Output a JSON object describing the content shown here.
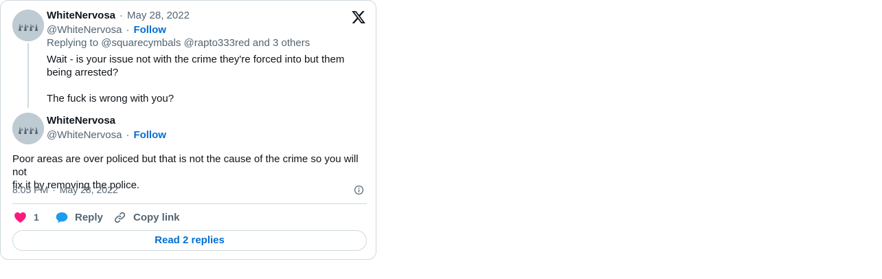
{
  "parent_tweet": {
    "author_name": "WhiteNervosa",
    "date": "May 28, 2022",
    "handle": "@WhiteNervosa",
    "follow_label": "Follow",
    "replying_prefix": "Replying to",
    "mention_1": "@squarecymbals",
    "mention_2": "@rapto333red",
    "replying_suffix": "and 3 others",
    "text_line1": "Wait - is your issue not with the crime they're forced into but them",
    "text_line2": "being arrested?",
    "text_line3": "The fuck is wrong with you?"
  },
  "main_tweet": {
    "author_name": "WhiteNervosa",
    "handle": "@WhiteNervosa",
    "follow_label": "Follow",
    "text_line1": "Poor areas are over policed but that is not the cause of the crime so you will not",
    "text_line2": "fix it by removing the police.",
    "time": "8:05 PM",
    "date": "May 28, 2022"
  },
  "actions": {
    "like_count": "1",
    "reply_label": "Reply",
    "copy_link_label": "Copy link",
    "read_replies_label": "Read 2 replies"
  },
  "icons": {
    "logo": "x-logo-icon",
    "like": "heart-icon",
    "reply": "speech-bubble-icon",
    "copy": "link-icon",
    "info": "info-icon"
  },
  "colors": {
    "link_blue": "#006fd6",
    "heart_pink": "#f91880",
    "reply_blue": "#1d9bf0",
    "muted_text": "#536471",
    "border": "#cfd9de"
  }
}
